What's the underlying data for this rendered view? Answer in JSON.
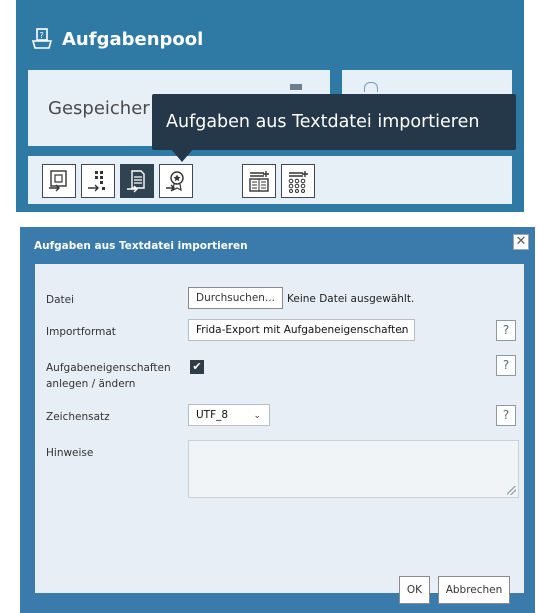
{
  "header": {
    "title": "Aufgabenpool",
    "icon": "task-pool-icon"
  },
  "cards": {
    "saved_label": "Gespeicher"
  },
  "toolbar": {
    "buttons": [
      {
        "name": "export-to-file-icon"
      },
      {
        "name": "distribute-tasks-icon"
      },
      {
        "name": "import-text-file-icon",
        "active": true
      },
      {
        "name": "export-certificate-icon"
      },
      {
        "name": "task-table-icon"
      },
      {
        "name": "add-task-grid-icon"
      }
    ],
    "tooltip": "Aufgaben aus Textdatei importieren"
  },
  "dialog": {
    "title": "Aufgaben aus Textdatei importieren",
    "close": "✕",
    "file": {
      "label": "Datei",
      "button": "Durchsuchen...",
      "status": "Keine Datei ausgewählt."
    },
    "format": {
      "label": "Importformat",
      "value": "Frida-Export mit Aufgabeneigenschaften"
    },
    "properties": {
      "label_line1": "Aufgabeneigenschaften",
      "label_line2": "anlegen / ändern",
      "checked": true
    },
    "charset": {
      "label": "Zeichensatz",
      "value": "UTF_8"
    },
    "notes": {
      "label": "Hinweise",
      "value": ""
    },
    "help": "?",
    "ok": "OK",
    "cancel": "Abbrechen"
  },
  "colors": {
    "header_bg": "#2f7aa5",
    "dialog_bg": "#3a7bac",
    "panel_bg": "#e7eef5",
    "tooltip_bg": "#24384a"
  }
}
